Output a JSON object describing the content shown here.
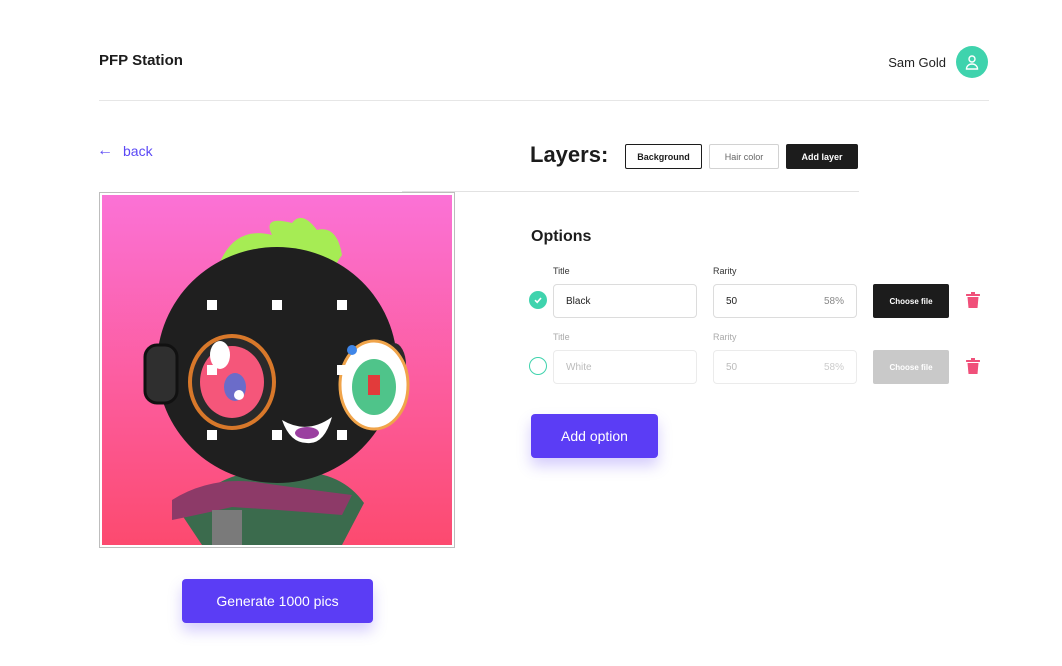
{
  "header": {
    "app_title": "PFP Station",
    "user_name": "Sam Gold",
    "avatar_icon": "user-icon"
  },
  "nav": {
    "back_label": "back",
    "back_icon": "arrow-left-icon"
  },
  "preview": {
    "image_desc_icon": "nft-character-image"
  },
  "generate": {
    "label": "Generate 1000 pics"
  },
  "layers": {
    "title": "Layers:",
    "tabs": [
      {
        "label": "Background",
        "state": "selected"
      },
      {
        "label": "Hair color",
        "state": "default"
      },
      {
        "label": "Add layer",
        "state": "primary"
      }
    ]
  },
  "options": {
    "title": "Options",
    "rows": [
      {
        "checked": true,
        "title_label": "Title",
        "title_value": "Black",
        "rarity_label": "Rarity",
        "rarity_value": "50",
        "rarity_percent": "58%",
        "file_label": "Choose file"
      },
      {
        "checked": false,
        "title_label": "Title",
        "title_placeholder": "White",
        "rarity_label": "Rarity",
        "rarity_value": "50",
        "rarity_percent": "58%",
        "file_label": "Choose file"
      }
    ],
    "add_label": "Add option"
  },
  "colors": {
    "accent": "#5b3df5",
    "teal": "#3fd3ad",
    "danger": "#f0507a",
    "dark": "#1c1c1c"
  }
}
